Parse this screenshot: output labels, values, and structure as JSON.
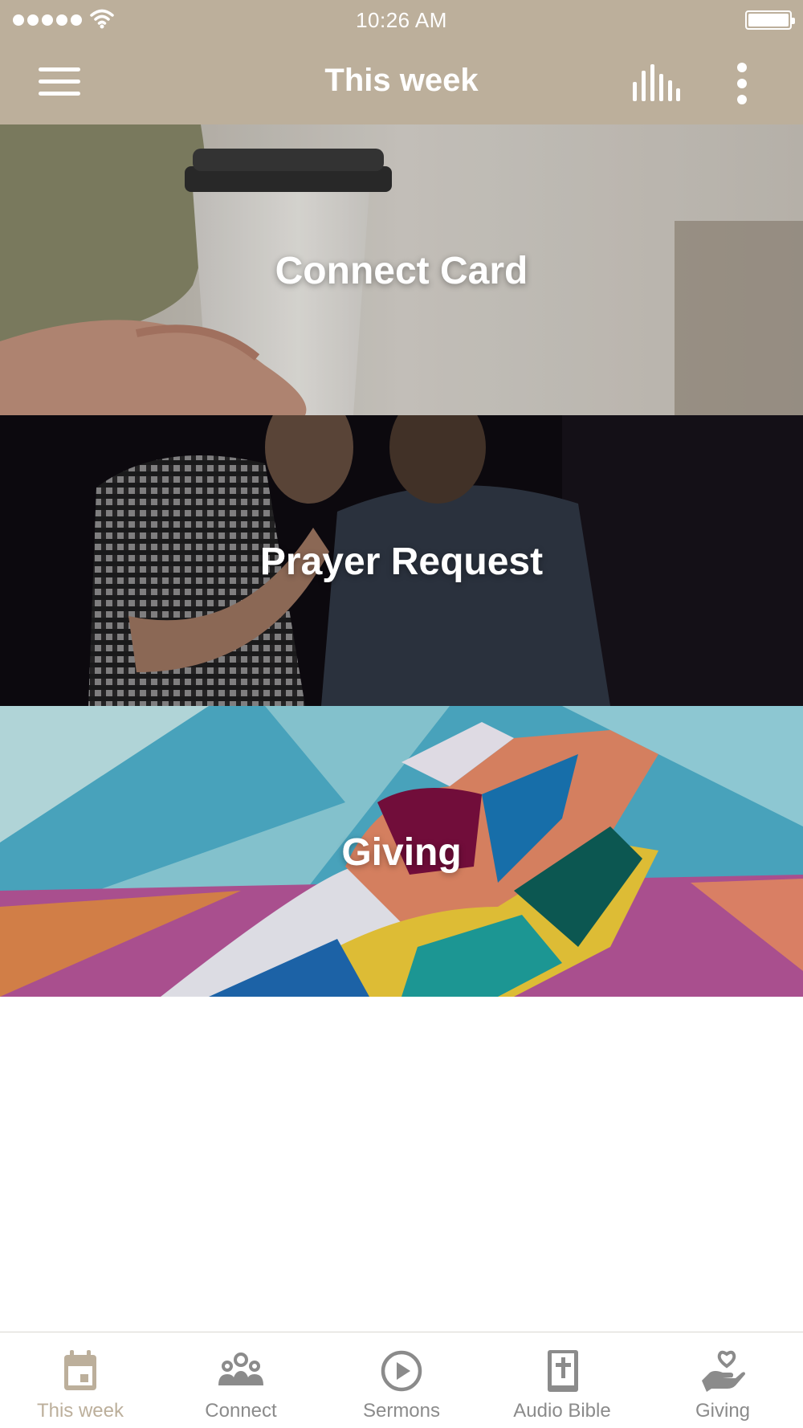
{
  "status_bar": {
    "time": "10:26 AM",
    "signal_icon": "signal-dots-icon",
    "wifi_icon": "wifi-icon",
    "battery_icon": "battery-full-icon",
    "battery_level": 1.0
  },
  "app_bar": {
    "title": "This week",
    "menu_icon": "hamburger-menu-icon",
    "audio_icon": "audio-levels-icon",
    "more_icon": "more-vertical-icon"
  },
  "cards": [
    {
      "label": "Connect Card",
      "image": "coffee-cup-photo"
    },
    {
      "label": "Prayer Request",
      "image": "two-men-praying-photo"
    },
    {
      "label": "Giving",
      "image": "painted-hands-mural-photo"
    }
  ],
  "tab_bar": {
    "active_index": 0,
    "tabs": [
      {
        "label": "This week",
        "icon": "calendar-icon"
      },
      {
        "label": "Connect",
        "icon": "people-group-icon"
      },
      {
        "label": "Sermons",
        "icon": "play-circle-icon"
      },
      {
        "label": "Audio Bible",
        "icon": "bible-icon"
      },
      {
        "label": "Giving",
        "icon": "heart-hand-icon"
      }
    ]
  },
  "colors": {
    "header_background": "#bcaf9b",
    "header_foreground": "#ffffff",
    "tab_active": "#bcaf9b",
    "tab_inactive": "#8b8b8b"
  }
}
